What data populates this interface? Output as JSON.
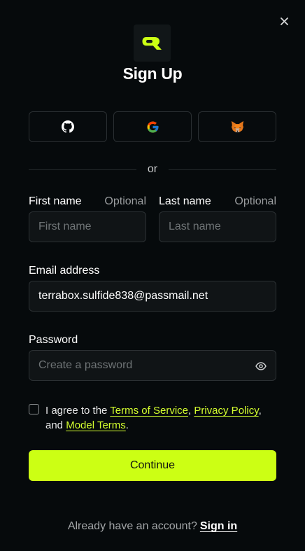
{
  "close_icon": "close-icon",
  "logo_icon": "brand-logo-icon",
  "title": "Sign Up",
  "social": [
    {
      "icon": "github-icon"
    },
    {
      "icon": "google-icon"
    },
    {
      "icon": "metamask-fox-icon"
    }
  ],
  "divider_text": "or",
  "first_name": {
    "label": "First name",
    "optional": "Optional",
    "value": "",
    "placeholder": "First name"
  },
  "last_name": {
    "label": "Last name",
    "optional": "Optional",
    "value": "",
    "placeholder": "Last name"
  },
  "email": {
    "label": "Email address",
    "value": "terrabox.sulfide838@passmail.net",
    "placeholder": ""
  },
  "password": {
    "label": "Password",
    "value": "",
    "placeholder": "Create a password",
    "toggle_icon": "eye-icon"
  },
  "terms": {
    "prefix": "I agree to the ",
    "tos": "Terms of Service",
    "sep1": ", ",
    "privacy": "Privacy Policy",
    "sep2": ", and ",
    "model": "Model Terms",
    "suffix": ".",
    "checked": false
  },
  "continue_label": "Continue",
  "footer": {
    "prompt": "Already have an account?",
    "link": "Sign in"
  },
  "colors": {
    "accent": "#ccff14",
    "link": "#d4ff2f",
    "background": "#060a0c"
  }
}
